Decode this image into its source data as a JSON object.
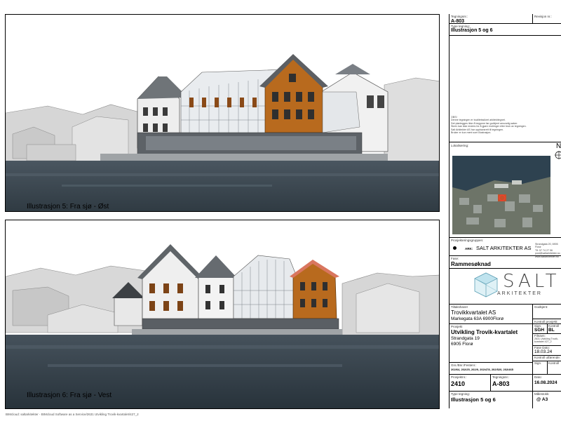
{
  "captions": {
    "top": "Illustrasjon 5: Fra sjø - Øst",
    "bottom": "Illustrasjon 6: Fra sjø - Vest"
  },
  "footer": "BIMcloud: saltarkitekter - BIMcloud Software as a Service/2631 Utvikling Trovik-kvartalet/427_2",
  "title_block": {
    "tegningsnr_label": "Tegningsnr.:",
    "tegningsnr": "A-803",
    "revisjon_label": "Revisjon nr.:",
    "type_label": "Type tegning:",
    "type": "Illustrasjon 5 og 6",
    "notes": [
      "OBS!",
      "Denne tegningen er kvalitetssikret arkitekttegnet.",
      "Det planlegges ikke å begynne før godkjent ansvarlig søker.",
      "Skrev kan ikke endres for å gjøre endringer etter bruk av tegningen.",
      "Salt Arkitekter AS har opphavsrett til tegningen.",
      "Bruker er kun ment som illustrasjon."
    ],
    "lokalisering_label": "Lokalisering:",
    "north_label": "N",
    "prosjekteringsgruppen_label": "Prosjekteringsgruppen:",
    "ark_label": "ARK:",
    "ark_company": "SALT ARKITEKTER AS",
    "ark_address": "Strandgata 20, 6905 Florø",
    "ark_phone": "Tlf: 57 74 27 96",
    "ark_email": "post@saltarkitekter.no",
    "ark_web": "www.saltarkitekter.no",
    "fase_label": "Fase:",
    "fase": "Rammesøknad",
    "logo_text": "SALT",
    "logo_sub": "ARKITEKTER",
    "tiltakshaver_label": "Tiltakshaver",
    "tiltakshaver": "Trovikkvartalet AS",
    "tiltakshaver_addr": "Markegata 63A 6900Florø",
    "godkjent_label": "Godkjent:",
    "kontroll_prosjekt_label": "Kontroll prosjekt:",
    "prosjekt_label": "Prosjekt",
    "prosjekt": "Utvikling Trovik-kvartalet",
    "prosjekt_addr1": "Strandgata 19",
    "prosjekt_addr2": "6905 Florø",
    "sign_label": "Sign.",
    "sign": "SGH",
    "kontroll_label": "Kontroll",
    "kontroll": "BL",
    "filnavn_label": "Filnavn:",
    "filnavn": "2631 Utvikling Trovik-kvartalet 427_2",
    "fase_dato_label": "Fase Dato:",
    "fase_dato": "18.03.24",
    "kontroll_utforende_label": "Kontroll utførende:",
    "sign2_label": "Sign.",
    "kontroll2_label": "Kontroll",
    "gnr_label": "Gnr./Bnr./Festenr.:",
    "gnr": "202/64, 202/25, 202/9, 202/478, 202/520, 202/465",
    "prosjektnr_label": "Prosjektnr.:",
    "prosjektnr": "2410",
    "tegningsnr2_label": "Tegningsnr.:",
    "tegningsnr2": "A-803",
    "dato_label": "Dato:",
    "dato": "16.08.2024",
    "type2_label": "Type tegning:",
    "type2": "Illustrasjon 5 og 6",
    "malestokk_label": "Målestokk:",
    "malestokk": "@ A3"
  },
  "colors": {
    "sea": "#3b4852",
    "timber": "#b86a1e",
    "roof": "#666c72",
    "frame": "#000000"
  }
}
